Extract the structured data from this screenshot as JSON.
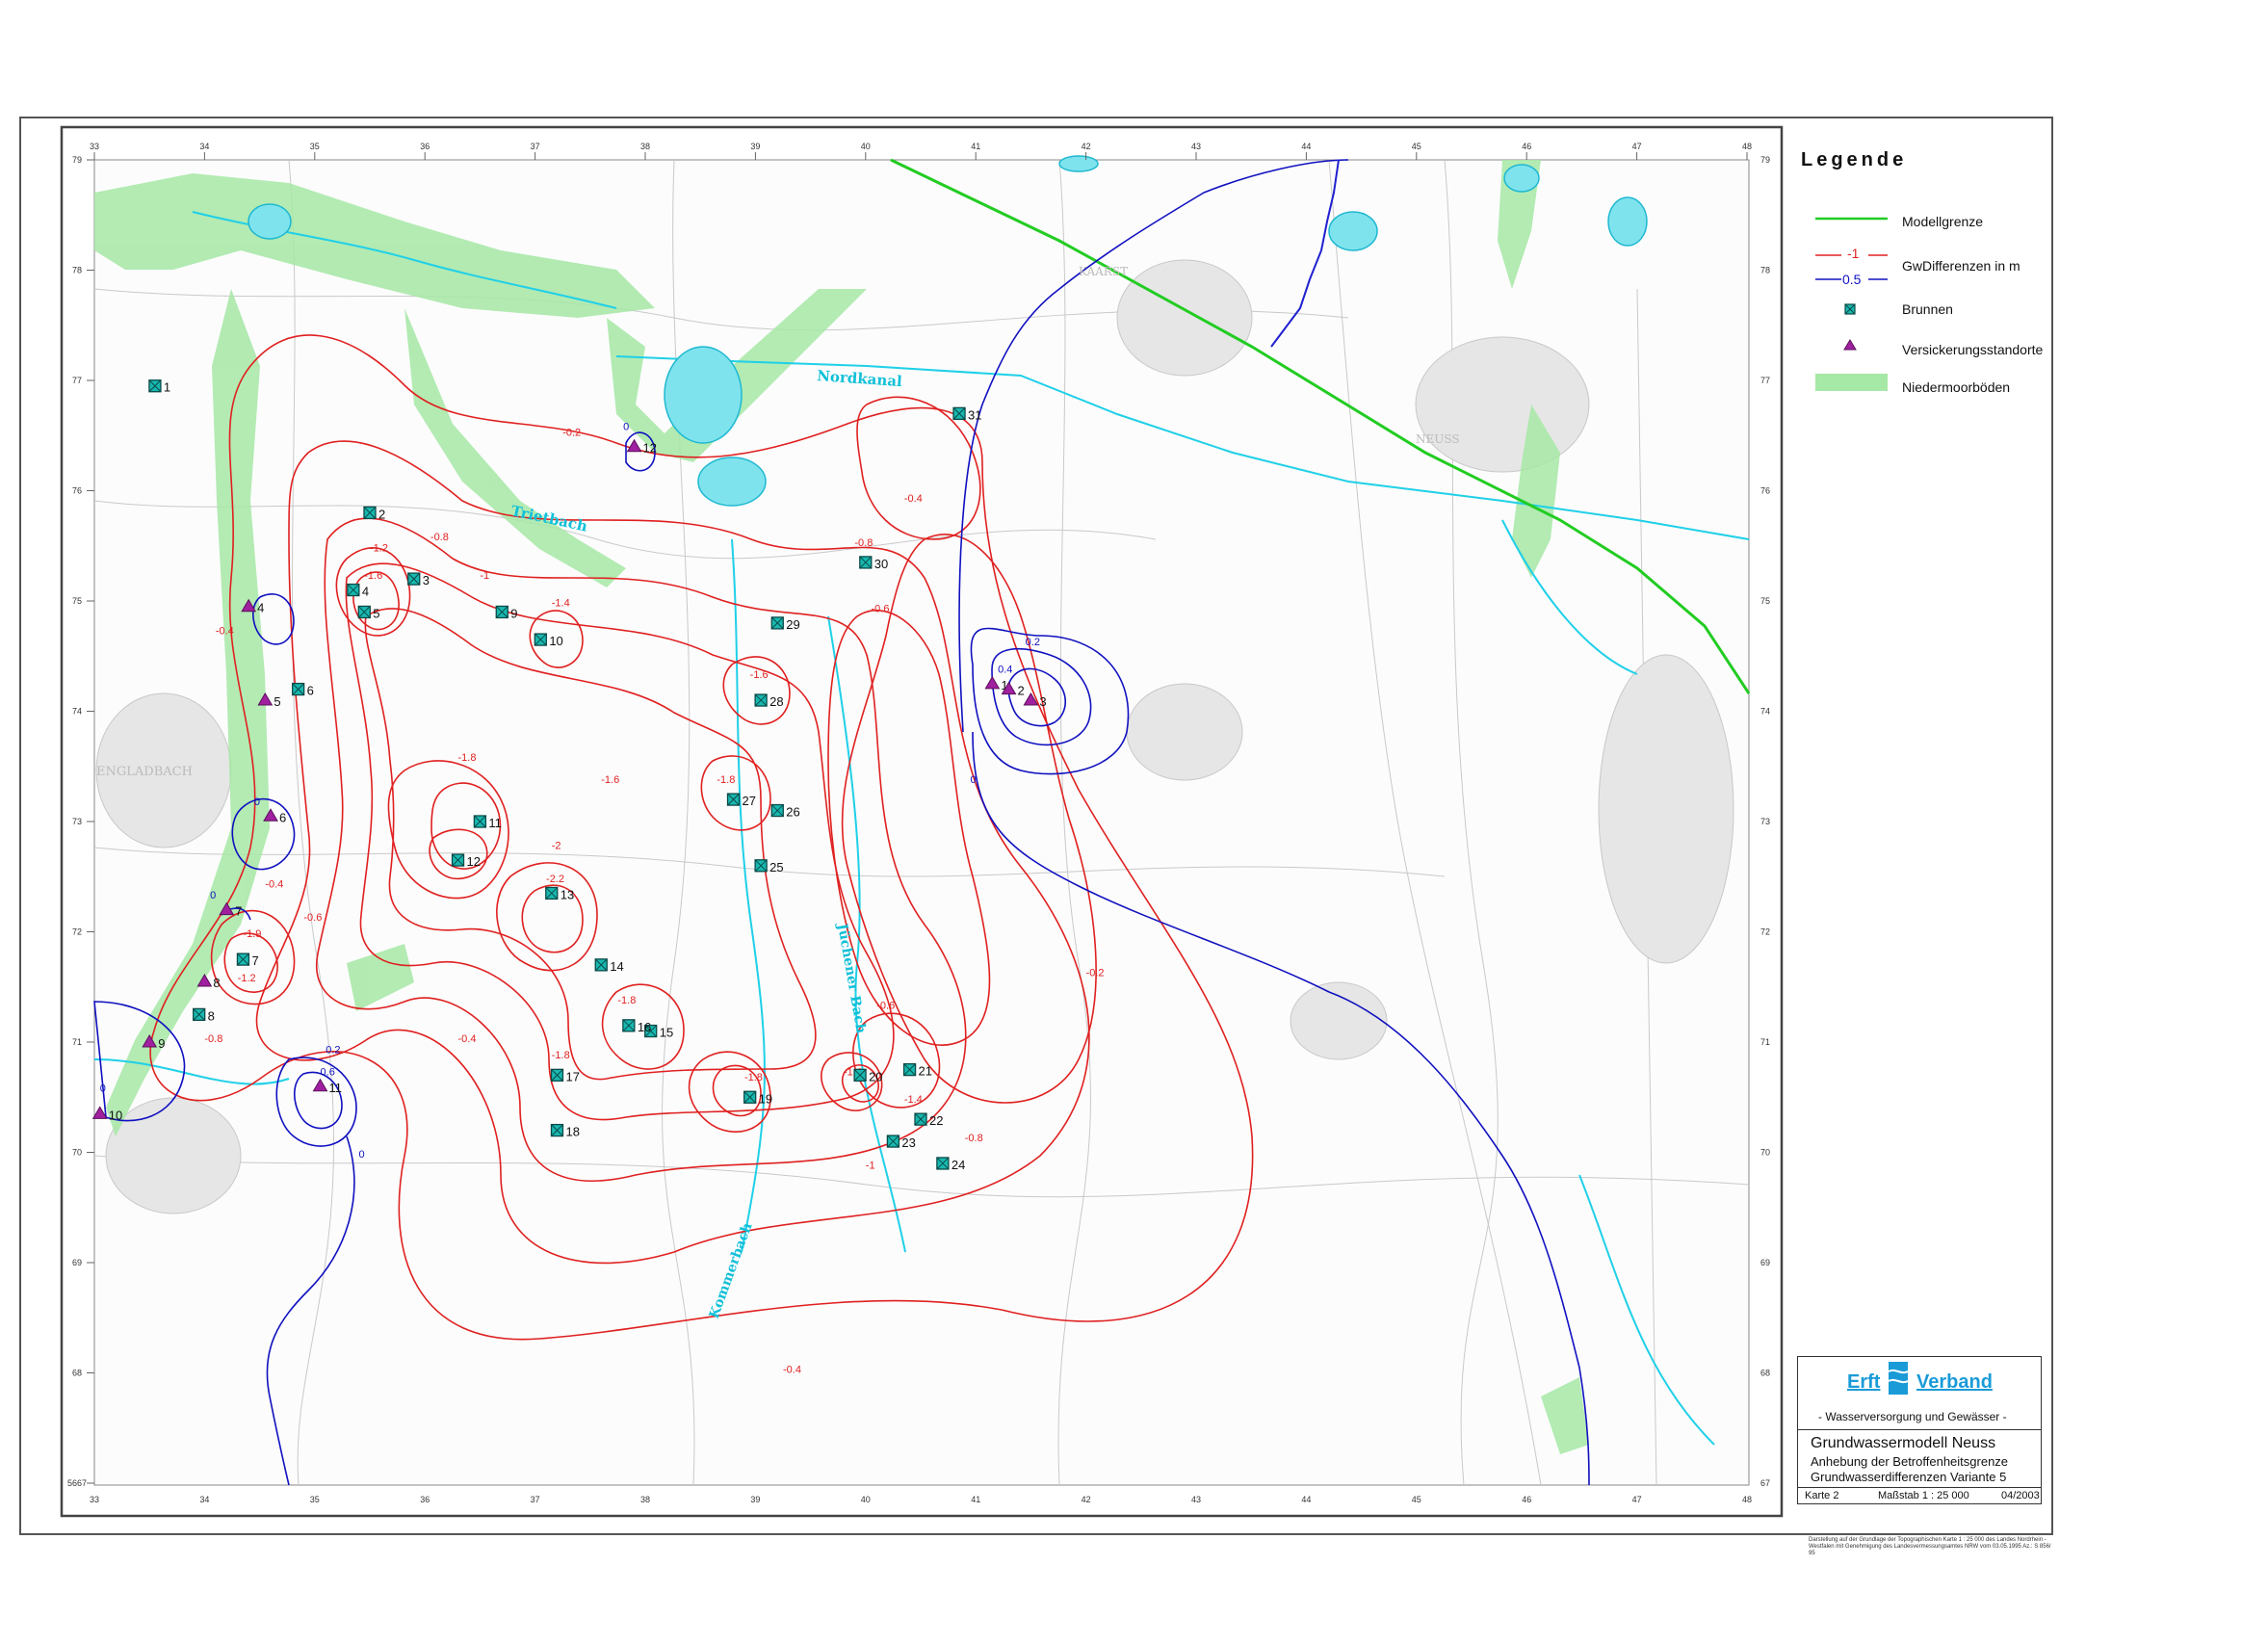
{
  "legend": {
    "title": "Legende",
    "items": [
      {
        "key": "model-boundary",
        "label": "Modellgrenze",
        "color": "#22cc22"
      },
      {
        "key": "gw-diff",
        "label": "GwDifferenzen in m",
        "sample_red": "-1",
        "sample_blue": "0.5",
        "color_red": "#e02020",
        "color_blue": "#1010c0"
      },
      {
        "key": "wells",
        "label": "Brunnen",
        "color": "#18b8b0"
      },
      {
        "key": "infiltration",
        "label": "Versickerungsstandorte",
        "color": "#a020a0"
      },
      {
        "key": "fen-soils",
        "label": "Niedermoorböden",
        "color": "#8fe08f"
      }
    ]
  },
  "title_block": {
    "org_left": "Erft",
    "org_right": "Verband",
    "subtitle": "- Wasserversorgung und Gewässer -",
    "title": "Grundwassermodell Neuss",
    "line2": "Anhebung der Betroffenheitsgrenze",
    "line3": "Grundwasserdifferenzen Variante 5",
    "sheet": "Karte 2",
    "scale": "Maßstab 1 : 25 000",
    "date": "04/2003",
    "footnote": "Darstellung auf der Grundlage der Topographischen Karte 1 : 25 000 des Landes Nordrhein - Westfalen mit Genehmigung des Landesvermessungsamtes NRW vom 03.05.1995 Az.: S 856/ 95"
  },
  "grid": {
    "x_labels": [
      "33",
      "34",
      "35",
      "36",
      "37",
      "38",
      "39",
      "40",
      "41",
      "42",
      "43",
      "44",
      "45",
      "46",
      "47",
      "48"
    ],
    "y_labels": [
      "79",
      "78",
      "77",
      "76",
      "75",
      "74",
      "73",
      "72",
      "71",
      "70",
      "69",
      "68",
      "67"
    ],
    "corner_label": "5667"
  },
  "place_labels": [
    "Nordkanal",
    "Trietbach",
    "Jüchener Bach",
    "Kommerbach",
    "ENGLADBACH",
    "KAARST",
    "NEUSS"
  ],
  "wells": [
    {
      "id": "1",
      "x": 33.55,
      "y": 76.95
    },
    {
      "id": "2",
      "x": 35.5,
      "y": 75.8
    },
    {
      "id": "3",
      "x": 35.9,
      "y": 75.2
    },
    {
      "id": "4",
      "x": 35.35,
      "y": 75.1
    },
    {
      "id": "5",
      "x": 35.45,
      "y": 74.9
    },
    {
      "id": "6",
      "x": 34.85,
      "y": 74.2
    },
    {
      "id": "7",
      "x": 34.35,
      "y": 71.75
    },
    {
      "id": "8",
      "x": 33.95,
      "y": 71.25
    },
    {
      "id": "9",
      "x": 36.7,
      "y": 74.9
    },
    {
      "id": "10",
      "x": 37.05,
      "y": 74.65
    },
    {
      "id": "11",
      "x": 36.5,
      "y": 73.0
    },
    {
      "id": "12",
      "x": 36.3,
      "y": 72.65
    },
    {
      "id": "13",
      "x": 37.15,
      "y": 72.35
    },
    {
      "id": "14",
      "x": 37.6,
      "y": 71.7
    },
    {
      "id": "15",
      "x": 38.05,
      "y": 71.1
    },
    {
      "id": "16",
      "x": 37.85,
      "y": 71.15
    },
    {
      "id": "17",
      "x": 37.2,
      "y": 70.7
    },
    {
      "id": "18",
      "x": 37.2,
      "y": 70.2
    },
    {
      "id": "19",
      "x": 38.95,
      "y": 70.5
    },
    {
      "id": "20",
      "x": 39.95,
      "y": 70.7
    },
    {
      "id": "21",
      "x": 40.4,
      "y": 70.75
    },
    {
      "id": "22",
      "x": 40.5,
      "y": 70.3
    },
    {
      "id": "23",
      "x": 40.25,
      "y": 70.1
    },
    {
      "id": "24",
      "x": 40.7,
      "y": 69.9
    },
    {
      "id": "25",
      "x": 39.05,
      "y": 72.6
    },
    {
      "id": "26",
      "x": 39.2,
      "y": 73.1
    },
    {
      "id": "27",
      "x": 38.8,
      "y": 73.2
    },
    {
      "id": "28",
      "x": 39.05,
      "y": 74.1
    },
    {
      "id": "29",
      "x": 39.2,
      "y": 74.8
    },
    {
      "id": "30",
      "x": 40.0,
      "y": 75.35
    },
    {
      "id": "31",
      "x": 40.85,
      "y": 76.7
    }
  ],
  "infiltration_sites": [
    {
      "id": "1",
      "x": 41.15,
      "y": 74.25
    },
    {
      "id": "2",
      "x": 41.3,
      "y": 74.2
    },
    {
      "id": "3",
      "x": 41.5,
      "y": 74.1
    },
    {
      "id": "4",
      "x": 34.4,
      "y": 74.95
    },
    {
      "id": "5",
      "x": 34.55,
      "y": 74.1
    },
    {
      "id": "6",
      "x": 34.6,
      "y": 73.05
    },
    {
      "id": "7",
      "x": 34.2,
      "y": 72.2
    },
    {
      "id": "8",
      "x": 34.0,
      "y": 71.55
    },
    {
      "id": "9",
      "x": 33.5,
      "y": 71.0
    },
    {
      "id": "10",
      "x": 33.05,
      "y": 70.35
    },
    {
      "id": "11",
      "x": 35.05,
      "y": 70.6
    },
    {
      "id": "12",
      "x": 37.9,
      "y": 76.4
    }
  ],
  "contour_labels": [
    {
      "t": "-0.2",
      "x": 37.25,
      "y": 76.5
    },
    {
      "t": "-0.4",
      "x": 40.35,
      "y": 75.9
    },
    {
      "t": "-0.6",
      "x": 40.05,
      "y": 74.9
    },
    {
      "t": "-0.8",
      "x": 39.9,
      "y": 75.5
    },
    {
      "t": "-1.2",
      "x": 35.5,
      "y": 75.45
    },
    {
      "t": "-0.8",
      "x": 36.05,
      "y": 75.55
    },
    {
      "t": "-1",
      "x": 36.5,
      "y": 75.2
    },
    {
      "t": "-1.6",
      "x": 35.45,
      "y": 75.2
    },
    {
      "t": "-1.4",
      "x": 37.15,
      "y": 74.95
    },
    {
      "t": "-1.6",
      "x": 38.95,
      "y": 74.3
    },
    {
      "t": "-1.6",
      "x": 37.6,
      "y": 73.35
    },
    {
      "t": "-1.8",
      "x": 36.3,
      "y": 73.55
    },
    {
      "t": "-1.8",
      "x": 38.65,
      "y": 73.35
    },
    {
      "t": "-2",
      "x": 37.15,
      "y": 72.75
    },
    {
      "t": "-2.2",
      "x": 37.1,
      "y": 72.45
    },
    {
      "t": "-1.8",
      "x": 37.75,
      "y": 71.35
    },
    {
      "t": "-1.8",
      "x": 37.15,
      "y": 70.85
    },
    {
      "t": "-1.8",
      "x": 38.9,
      "y": 70.65
    },
    {
      "t": "-1.4",
      "x": 39.8,
      "y": 70.7
    },
    {
      "t": "-1.4",
      "x": 40.35,
      "y": 70.45
    },
    {
      "t": "-1",
      "x": 40.0,
      "y": 69.85
    },
    {
      "t": "-0.8",
      "x": 40.9,
      "y": 70.1
    },
    {
      "t": "-0.4",
      "x": 36.3,
      "y": 71.0
    },
    {
      "t": "-0.6",
      "x": 34.9,
      "y": 72.1
    },
    {
      "t": "-0.4",
      "x": 34.55,
      "y": 72.4
    },
    {
      "t": "-1.2",
      "x": 34.3,
      "y": 71.55
    },
    {
      "t": "-0.8",
      "x": 34.0,
      "y": 71.0
    },
    {
      "t": "-1.9",
      "x": 34.35,
      "y": 71.95
    },
    {
      "t": "-0.4",
      "x": 39.25,
      "y": 68.0
    },
    {
      "t": "-0.2",
      "x": 42.0,
      "y": 71.6
    },
    {
      "t": "-0.6",
      "x": 40.1,
      "y": 71.3
    },
    {
      "t": "-0.4",
      "x": 34.1,
      "y": 74.7
    }
  ],
  "blue_labels": [
    {
      "t": "0",
      "x": 37.8,
      "y": 76.55
    },
    {
      "t": "0.2",
      "x": 41.45,
      "y": 74.6
    },
    {
      "t": "0.4",
      "x": 41.2,
      "y": 74.35
    },
    {
      "t": "0",
      "x": 40.95,
      "y": 73.35
    },
    {
      "t": "0",
      "x": 34.45,
      "y": 73.15
    },
    {
      "t": "0",
      "x": 34.05,
      "y": 72.3
    },
    {
      "t": "0.2",
      "x": 35.1,
      "y": 70.9
    },
    {
      "t": "0.6",
      "x": 35.05,
      "y": 70.7
    },
    {
      "t": "0",
      "x": 35.4,
      "y": 69.95
    },
    {
      "t": "0",
      "x": 33.05,
      "y": 70.55
    }
  ]
}
